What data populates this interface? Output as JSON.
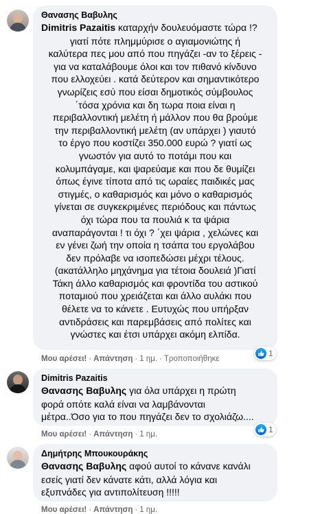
{
  "comments": [
    {
      "author": "Θανασης Βαβυλης",
      "mention": "Dimitris Pazaitis",
      "lines": [
        " καταρχήν δουλευόμαστε τώρα !?",
        "γιατί πότε πλημμύρισε ο αγιαμονιώτης ή",
        "καλύτερα πες μου από που πηγάζει -αν το ξέρεις -",
        "για να καταλάβουμε όλοι και τον πιθανό κίνδυνο",
        "που ελλοχεύει . κατά δεύτερον και σημαντικότερο",
        "γνωρίζεις εσύ που είσαι δημοτικός σύμβουλος",
        "΄τόσα χρόνια και δη τωρα ποια είναι η",
        "περιβαλλοντική μελέτη ή μάλλον που θα βρούμε",
        "την περιβαλλοντική μελέτη (αν υπάρχει ) γιαυτό",
        "το έργο που κοστίζει 350.000 ευρώ ? γιατί ως",
        "γνωστόν για αυτό το ποτάμι που και",
        "κολυμπάγαμε, και ψαρεύαμε και που δε θυμίζει",
        "όπως έγινε τίποτα από τις ωραίες παιδικές μας",
        "στιγμές, ο καθαρισμός και μόνο ο καθαρισμός",
        "γίνεται σε συγκεκριμένες περιόδους και πάντως",
        "όχι τώρα που τα πουλιά κ τα ψάρια",
        "αναπαράγονται ! τι όχι ? ΄χει ψάρια , χελώνες και",
        "εν γένει ζωή την οποία η τσάπα του εργολάβου",
        "δεν πρόλαβε να ισοπεδώσει μέχρι τέλους.",
        "(ακατάλληλο μηχάνημα για τέτοια δουλειά )Γιατί",
        "Τάκη άλλο καθαρισμός και φροντίδα του αστικού",
        "ποταμιού που χρειάζεται και άλλο αυλάκι που",
        "θέλετε να το κάνετε . Ευτυχώς που υπήρξαν",
        "αντιδράσεις και παρεμβάσεις από πολίτες και",
        "γνώστες και έτσι υπάρχει ακόμη ελπίδα."
      ],
      "like": "Μου αρέσει!",
      "reply": "Απάντηση",
      "time": "1 ημ.",
      "edited": "Τροποποιήθηκε",
      "reactions": "1"
    },
    {
      "author": "Dimitris Pazaitis",
      "mention": "Θανασης Βαβυλης",
      "lines": [
        " για όλα υπάρχει η πρώτη",
        "φορά οπότε καλά είναι να λαμβάνονται",
        "μέτρα..Όσο για το που πηγάζει δεν το σχολιάζω...."
      ],
      "like": "Μου αρέσει!",
      "reply": "Απάντηση",
      "time": "1 ημ.",
      "reactions": "1"
    },
    {
      "author": "Δημήτρης Μπουκουράκης",
      "mention": "Θανασης Βαβυλης",
      "lines": [
        " αφού αυτοί το κάνανε κανάλι",
        "εσείς γιατί δεν κάνατε κάτι, αλλά λόγια και",
        "εξυπνάδες για αντιπολίτευση !!!!!"
      ],
      "like": "Μου αρέσει!",
      "reply": "Απάντηση",
      "time": "1 ημ."
    }
  ]
}
